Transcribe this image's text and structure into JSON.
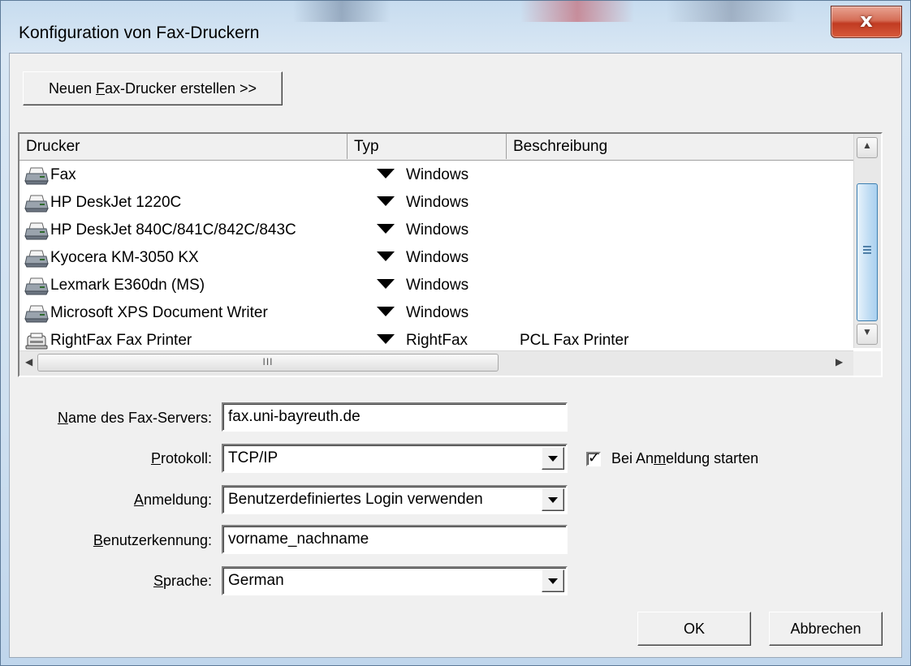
{
  "window": {
    "title": "Konfiguration von Fax-Druckern",
    "close_glyph": "x"
  },
  "toolbar": {
    "new_printer": {
      "pre": "Neuen ",
      "mnemonic": "F",
      "post": "ax-Drucker erstellen >>"
    }
  },
  "list": {
    "columns": [
      "Drucker",
      "Typ",
      "Beschreibung"
    ],
    "rows": [
      {
        "name": "Fax",
        "type": "Windows",
        "description": "",
        "icon": "printer-icon"
      },
      {
        "name": "HP DeskJet 1220C",
        "type": "Windows",
        "description": "",
        "icon": "printer-icon"
      },
      {
        "name": "HP DeskJet 840C/841C/842C/843C",
        "type": "Windows",
        "description": "",
        "icon": "printer-icon"
      },
      {
        "name": "Kyocera KM-3050 KX",
        "type": "Windows",
        "description": "",
        "icon": "printer-icon"
      },
      {
        "name": "Lexmark E360dn (MS)",
        "type": "Windows",
        "description": "",
        "icon": "printer-icon"
      },
      {
        "name": "Microsoft XPS Document Writer",
        "type": "Windows",
        "description": "",
        "icon": "printer-icon"
      },
      {
        "name": "RightFax Fax Printer",
        "type": "RightFax",
        "description": "PCL Fax Printer",
        "icon": "fax-printer-icon"
      }
    ],
    "hscroll_grip": "III"
  },
  "form": {
    "server": {
      "pre": "",
      "mnemonic": "N",
      "post": "ame des Fax-Servers:",
      "value": "fax.uni-bayreuth.de"
    },
    "protocol": {
      "pre": "",
      "mnemonic": "P",
      "post": "rotokoll:",
      "value": "TCP/IP"
    },
    "startup": {
      "pre": "Bei An",
      "mnemonic": "m",
      "post": "eldung starten",
      "checked": true
    },
    "login": {
      "pre": "",
      "mnemonic": "A",
      "post": "nmeldung:",
      "value": "Benutzerdefiniertes Login verwenden"
    },
    "user": {
      "pre": "",
      "mnemonic": "B",
      "post": "enutzerkennung:",
      "value": "vorname_nachname"
    },
    "language": {
      "pre": "",
      "mnemonic": "S",
      "post": "prache:",
      "value": "German"
    }
  },
  "buttons": {
    "ok": "OK",
    "cancel": "Abbrechen"
  }
}
